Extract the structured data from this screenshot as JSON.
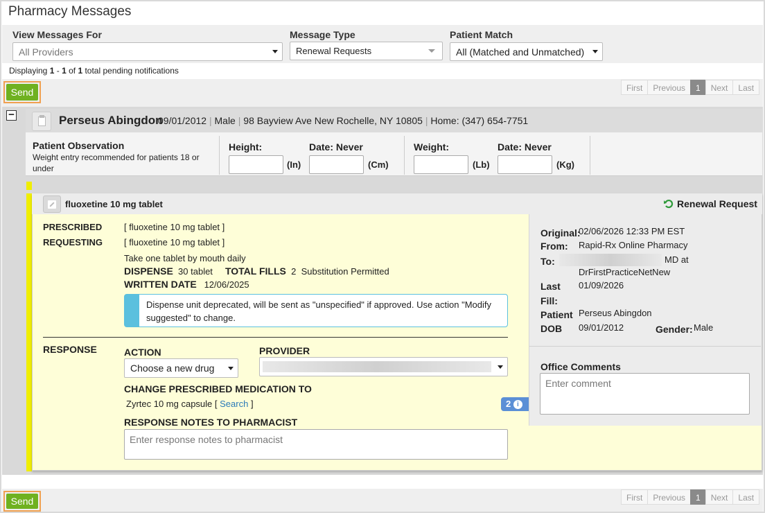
{
  "page": {
    "title": "Pharmacy Messages"
  },
  "filters": {
    "providers_label": "View Messages For",
    "providers_value": "All Providers",
    "type_label": "Message Type",
    "type_value": "Renewal Requests",
    "match_label": "Patient Match",
    "match_value": "All (Matched and Unmatched)"
  },
  "display": {
    "prefix": "Displaying ",
    "from": "1",
    "dash": " - ",
    "to": "1",
    "of": " of ",
    "total": "1",
    "suffix": " total pending notifications"
  },
  "toolbar": {
    "send_label": "Send"
  },
  "pager": {
    "first": "First",
    "previous": "Previous",
    "current": "1",
    "next": "Next",
    "last": "Last"
  },
  "patient": {
    "collapse_symbol": "−",
    "name": "Perseus Abingdon",
    "dob": "09/01/2012",
    "sex": "Male",
    "address": "98 Bayview Ave New Rochelle, NY 10805",
    "phone": "Home: (347) 654-7751"
  },
  "observation": {
    "title": "Patient Observation",
    "subtitle": "Weight entry recommended for patients 18 or under",
    "height_label": "Height:",
    "height_date": "Date: Never",
    "height_unit_in": "(In)",
    "height_unit_cm": "(Cm)",
    "weight_label": "Weight:",
    "weight_date": "Date: Never",
    "weight_unit_lb": "(Lb)",
    "weight_unit_kg": "(Kg)"
  },
  "rx": {
    "drug_title": "fluoxetine 10 mg tablet",
    "request_type": "Renewal Request",
    "prescribed_label": "PRESCRIBED",
    "prescribed_value": "[ fluoxetine 10 mg tablet ]",
    "requesting_label": "REQUESTING",
    "requesting_value": "[ fluoxetine 10 mg tablet ]",
    "sig": "Take one tablet by mouth daily",
    "dispense_label": "DISPENSE",
    "dispense_value": "30 tablet",
    "fills_label": "TOTAL FILLS",
    "fills_value": "2",
    "substitution": "Substitution Permitted",
    "written_label": "WRITTEN DATE",
    "written_value": "12/06/2025",
    "warning": "Dispense unit deprecated, will be sent as \"unspecified\" if approved. Use action \"Modify suggested\" to change."
  },
  "response": {
    "label": "RESPONSE",
    "action_label": "ACTION",
    "action_value": "Choose a new drug",
    "provider_label": "PROVIDER",
    "change_label": "CHANGE PRESCRIBED MEDICATION TO",
    "new_drug": "Zyrtec 10 mg capsule",
    "search_open": "[ ",
    "search_link": "Search",
    "search_close": " ]",
    "info_count": "2",
    "notes_label": "RESPONSE NOTES TO PHARMACIST",
    "notes_placeholder": "Enter response notes to pharmacist"
  },
  "details": {
    "original_label": "Original:",
    "original_value": "02/06/2026 12:33 PM EST",
    "from_label": "From:",
    "from_value": "Rapid-Rx Online Pharmacy",
    "to_label": "To:",
    "to_value_suffix": "MD at",
    "to_value_line2": "DrFirstPracticeNetNew",
    "lastfill_label_1": "Last",
    "lastfill_label_2": "Fill:",
    "lastfill_value": "01/09/2026",
    "patient_label": "Patient",
    "patient_value": "Perseus Abingdon",
    "dob_label": "DOB",
    "dob_value": "09/01/2012",
    "gender_label": "Gender:",
    "gender_value": "Male",
    "comments_label": "Office Comments",
    "comments_placeholder": "Enter comment"
  },
  "colors": {
    "send": "#6fb120",
    "accent_yellow": "#f0ee00",
    "info": "#5bc0de",
    "link": "#2a7ab8",
    "renew_icon": "#2e9a3a"
  }
}
